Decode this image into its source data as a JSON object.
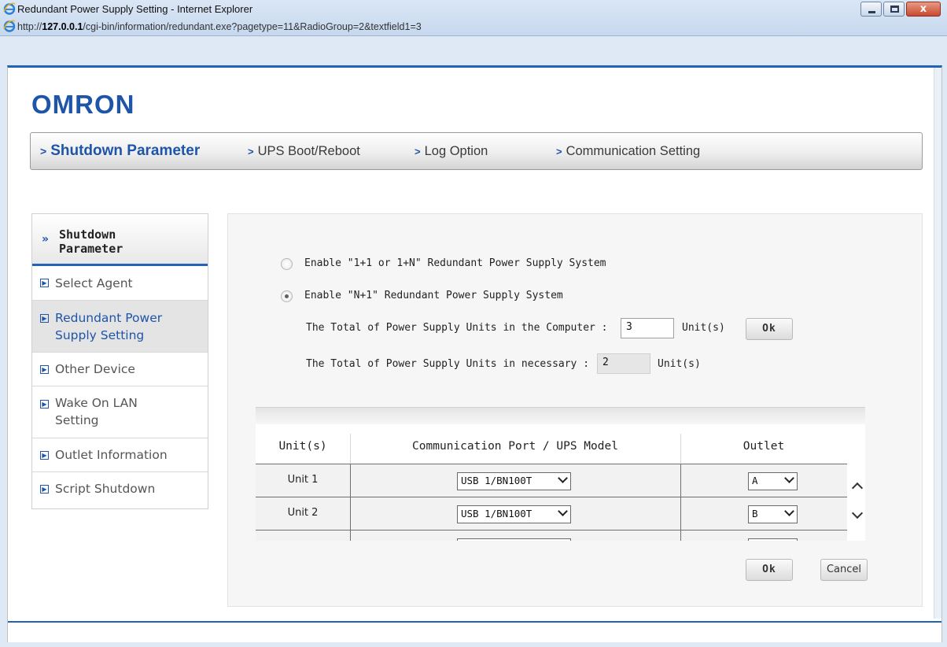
{
  "window": {
    "title": "Redundant Power Supply Setting - Internet Explorer",
    "url_prefix": "http://",
    "url_host": "127.0.0.1",
    "url_path": "/cgi-bin/information/redundant.exe?pagetype=11&RadioGroup=2&textfield1=3",
    "close_label": "x"
  },
  "brand": {
    "logo_text": "OMRON",
    "color": "#1e55a8"
  },
  "topnav": {
    "chevron": ">",
    "items": [
      {
        "label": "Shutdown Parameter",
        "active": true
      },
      {
        "label": "UPS Boot/Reboot"
      },
      {
        "label": "Log Option"
      },
      {
        "label": "Communication Setting"
      }
    ]
  },
  "sidebar": {
    "header_marker": "»",
    "header": "Shutdown Parameter",
    "item_icon": "▶",
    "items": [
      {
        "label": "Select Agent"
      },
      {
        "label": "Redundant Power Supply Setting",
        "active": true
      },
      {
        "label": "Other Device"
      },
      {
        "label": "Wake On LAN Setting"
      },
      {
        "label": "Outlet Information"
      },
      {
        "label": "Script Shutdown"
      }
    ]
  },
  "form": {
    "option1_label": "Enable \"1+1 or 1+N\" Redundant Power Supply System",
    "option2_label": "Enable \"N+1\" Redundant Power Supply System",
    "option_selected": 2,
    "total_label": "The Total of Power Supply Units in the Computer :",
    "total_value": "3",
    "total_unit": "Unit(s)",
    "ok_label": "Ok",
    "necessary_label": "The Total of Power Supply Units in necessary :",
    "necessary_value": "2",
    "necessary_unit": "Unit(s)"
  },
  "table": {
    "headers": [
      "Unit(s)",
      "Communication Port / UPS Model",
      "Outlet"
    ],
    "rows": [
      {
        "unit": "Unit 1",
        "port": "USB 1/BN100T",
        "outlet": "A"
      },
      {
        "unit": "Unit 2",
        "port": "USB 1/BN100T",
        "outlet": "B"
      }
    ]
  },
  "footer": {
    "ok_label": "Ok",
    "cancel_label": "Cancel"
  }
}
